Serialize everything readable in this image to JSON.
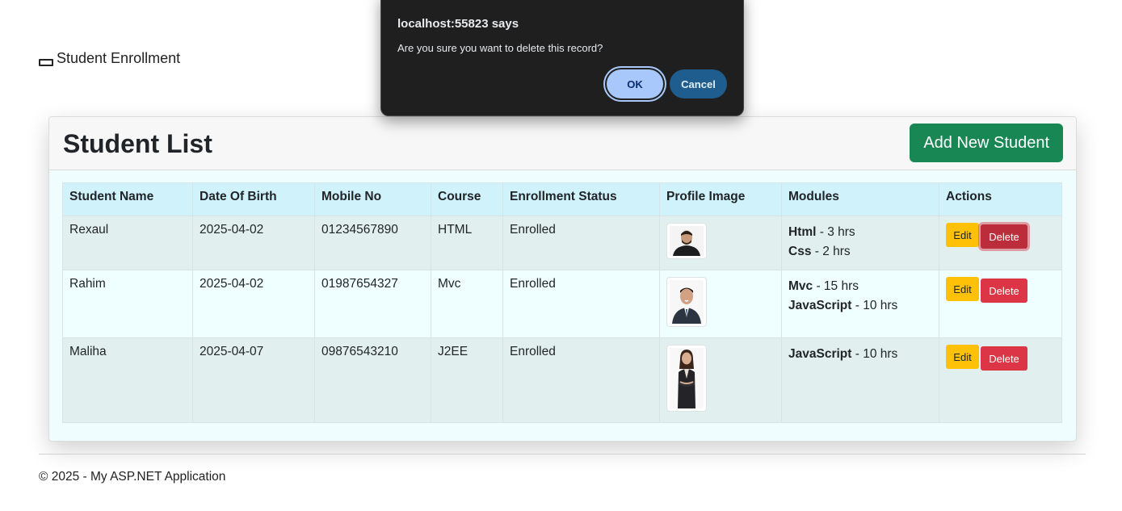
{
  "navbar": {
    "brand": "Student Enrollment"
  },
  "card": {
    "title": "Student List",
    "add_button": "Add New Student"
  },
  "table": {
    "headers": [
      "Student Name",
      "Date Of Birth",
      "Mobile No",
      "Course",
      "Enrollment Status",
      "Profile Image",
      "Modules",
      "Actions"
    ],
    "rows": [
      {
        "name": "Rexaul",
        "dob": "2025-04-02",
        "mobile": "01234567890",
        "course": "HTML",
        "status": "Enrolled",
        "modules": [
          {
            "name": "Html",
            "duration": " - 3 hrs"
          },
          {
            "name": "Css",
            "duration": " - 2 hrs"
          }
        ],
        "edit": "Edit",
        "delete": "Delete"
      },
      {
        "name": "Rahim",
        "dob": "2025-04-02",
        "mobile": "01987654327",
        "course": "Mvc",
        "status": "Enrolled",
        "modules": [
          {
            "name": "Mvc",
            "duration": " - 15 hrs"
          },
          {
            "name": "JavaScript",
            "duration": " - 10 hrs"
          }
        ],
        "edit": "Edit",
        "delete": "Delete"
      },
      {
        "name": "Maliha",
        "dob": "2025-04-07",
        "mobile": "09876543210",
        "course": "J2EE",
        "status": "Enrolled",
        "modules": [
          {
            "name": "JavaScript",
            "duration": " - 10 hrs"
          }
        ],
        "edit": "Edit",
        "delete": "Delete"
      }
    ]
  },
  "footer": {
    "text": "© 2025 - My ASP.NET Application"
  },
  "dialog": {
    "title": "localhost:55823 says",
    "message": "Are you sure you want to delete this record?",
    "ok": "OK",
    "cancel": "Cancel"
  },
  "colors": {
    "add_button": "#198754",
    "edit_button": "#ffc107",
    "delete_button": "#dc3545",
    "table_header": "#d0f2fb",
    "dialog_bg": "#1f1f1f",
    "ok_button": "#a8c7fa",
    "cancel_button": "#1e5d8d"
  }
}
